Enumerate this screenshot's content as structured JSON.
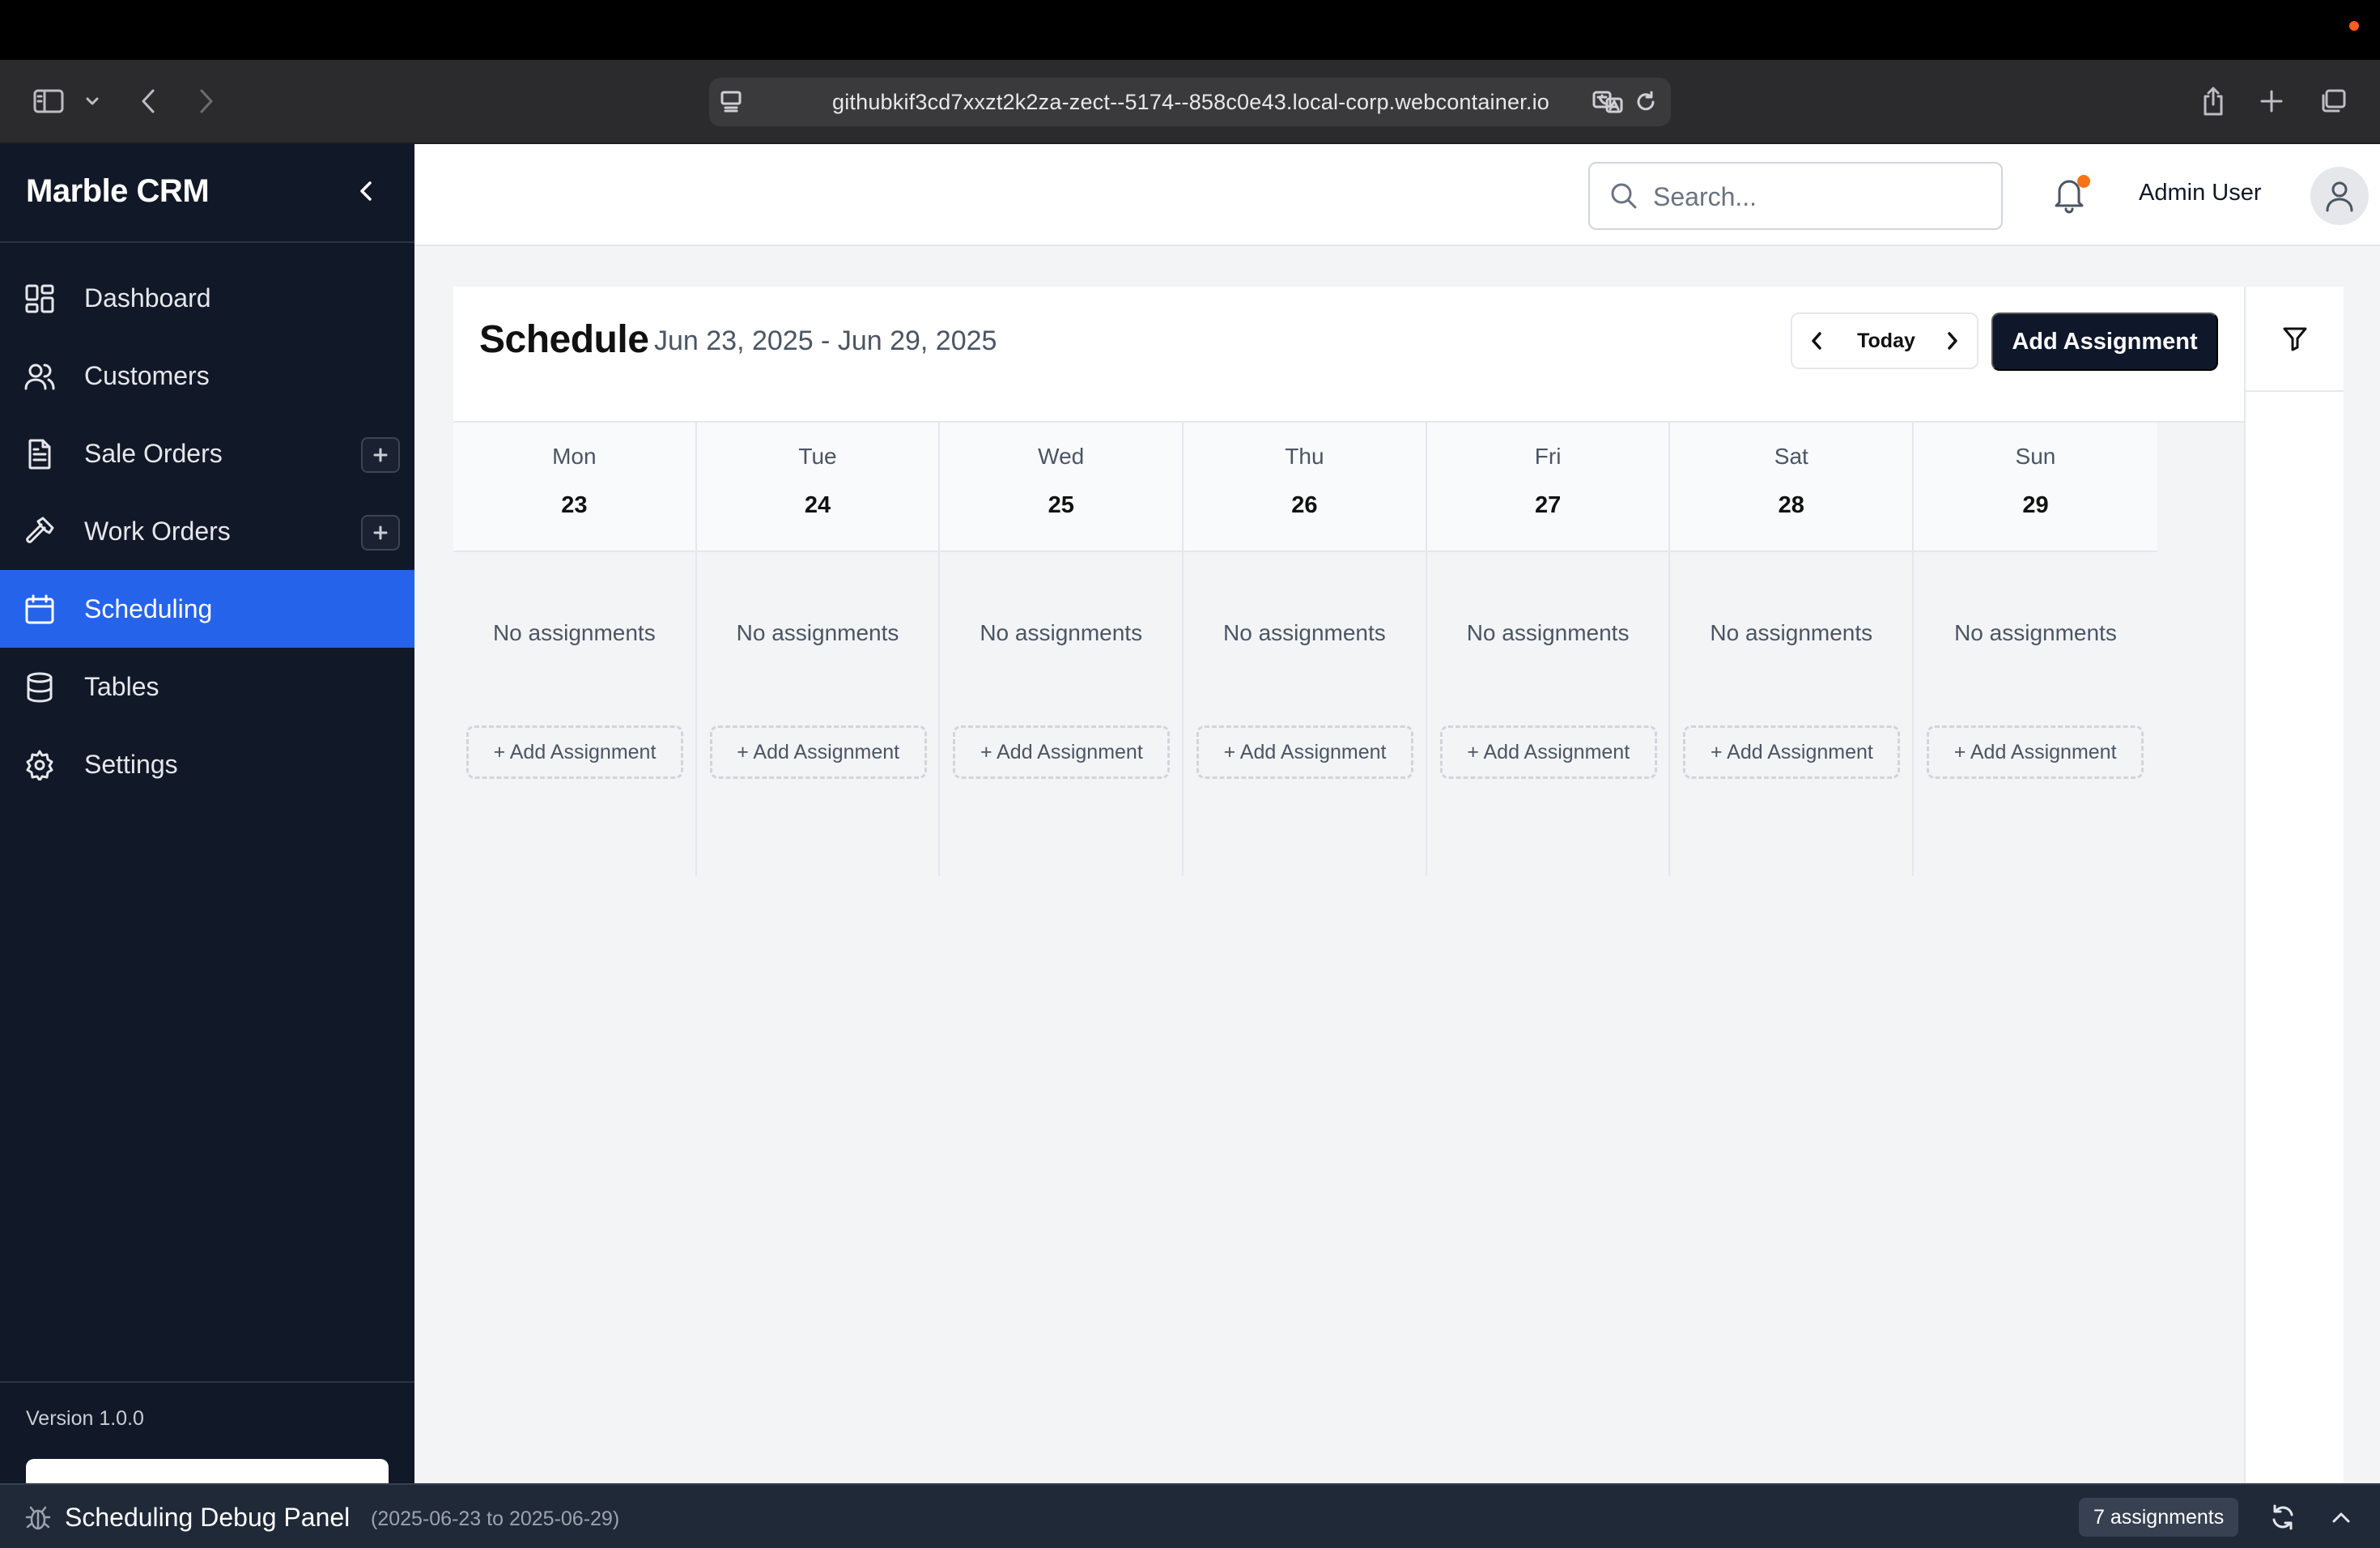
{
  "browser": {
    "url": "githubkif3cd7xxzt2k2za-zect--5174--858c0e43.local-corp.webcontainer.io"
  },
  "sidebar": {
    "brand": "Marble CRM",
    "items": [
      {
        "label": "Dashboard",
        "icon": "dashboard-icon"
      },
      {
        "label": "Customers",
        "icon": "users-icon"
      },
      {
        "label": "Sale Orders",
        "icon": "document-icon"
      },
      {
        "label": "Work Orders",
        "icon": "hammer-icon"
      },
      {
        "label": "Scheduling",
        "icon": "calendar-icon",
        "active": true
      },
      {
        "label": "Tables",
        "icon": "database-icon"
      },
      {
        "label": "Settings",
        "icon": "gear-icon"
      }
    ],
    "version": "Version 1.0.0"
  },
  "header": {
    "search_placeholder": "Search...",
    "user_name": "Admin User"
  },
  "schedule": {
    "title": "Schedule",
    "range": "Jun 23, 2025 - Jun 29, 2025",
    "today_label": "Today",
    "add_label": "Add Assignment",
    "days": [
      {
        "name": "Mon",
        "num": "23",
        "empty": "No assignments",
        "add": "+ Add Assignment"
      },
      {
        "name": "Tue",
        "num": "24",
        "empty": "No assignments",
        "add": "+ Add Assignment"
      },
      {
        "name": "Wed",
        "num": "25",
        "empty": "No assignments",
        "add": "+ Add Assignment"
      },
      {
        "name": "Thu",
        "num": "26",
        "empty": "No assignments",
        "add": "+ Add Assignment"
      },
      {
        "name": "Fri",
        "num": "27",
        "empty": "No assignments",
        "add": "+ Add Assignment"
      },
      {
        "name": "Sat",
        "num": "28",
        "empty": "No assignments",
        "add": "+ Add Assignment"
      },
      {
        "name": "Sun",
        "num": "29",
        "empty": "No assignments",
        "add": "+ Add Assignment"
      }
    ]
  },
  "debug": {
    "title": "Scheduling Debug Panel",
    "range": "(2025-06-23 to 2025-06-29)",
    "count": "7 assignments"
  },
  "colors": {
    "sidebar_bg": "#111827",
    "active": "#2563eb",
    "primary_button": "#0f172a",
    "notification_badge": "#f97316"
  }
}
